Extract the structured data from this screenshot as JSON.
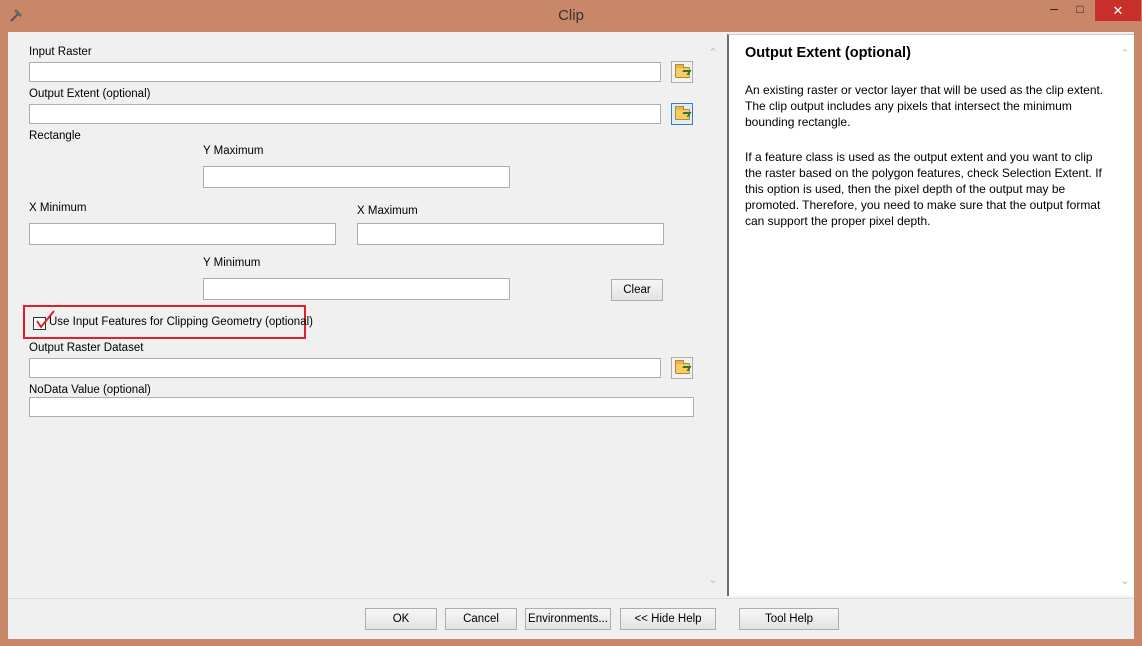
{
  "window": {
    "title": "Clip",
    "app_icon": "hammer-icon",
    "controls": {
      "minimize": "–",
      "maximize": "□",
      "close": "✕"
    }
  },
  "form": {
    "input_raster_label": "Input Raster",
    "input_raster_value": "",
    "output_extent_label": "Output Extent (optional)",
    "output_extent_value": "",
    "rectangle_label": "Rectangle",
    "y_max_label": "Y Maximum",
    "y_max_value": "",
    "x_min_label": "X Minimum",
    "x_min_value": "",
    "x_max_label": "X Maximum",
    "x_max_value": "",
    "y_min_label": "Y Minimum",
    "y_min_value": "",
    "clear_label": "Clear",
    "use_input_features_label": "Use Input Features for Clipping Geometry (optional)",
    "use_input_features_checked": true,
    "output_raster_label": "Output Raster Dataset",
    "output_raster_value": "",
    "nodata_label": "NoData Value (optional)",
    "nodata_value": ""
  },
  "help": {
    "title": "Output Extent (optional)",
    "paragraph1": "An existing raster or vector layer that will be used as the clip extent. The clip output includes any pixels that intersect the minimum bounding rectangle.",
    "paragraph2": "If a feature class is used as the output extent and you want to clip the raster based on the polygon features, check Selection Extent. If this option is used, then the pixel depth of the output may be promoted. Therefore, you need to make sure that the output format can support the proper pixel depth."
  },
  "buttons": {
    "ok": "OK",
    "cancel": "Cancel",
    "environments": "Environments...",
    "hide_help": "<< Hide Help",
    "tool_help": "Tool Help"
  },
  "colors": {
    "highlight": "#e0202a",
    "title_bar": "#c9876a",
    "close_button": "#c9302c"
  }
}
